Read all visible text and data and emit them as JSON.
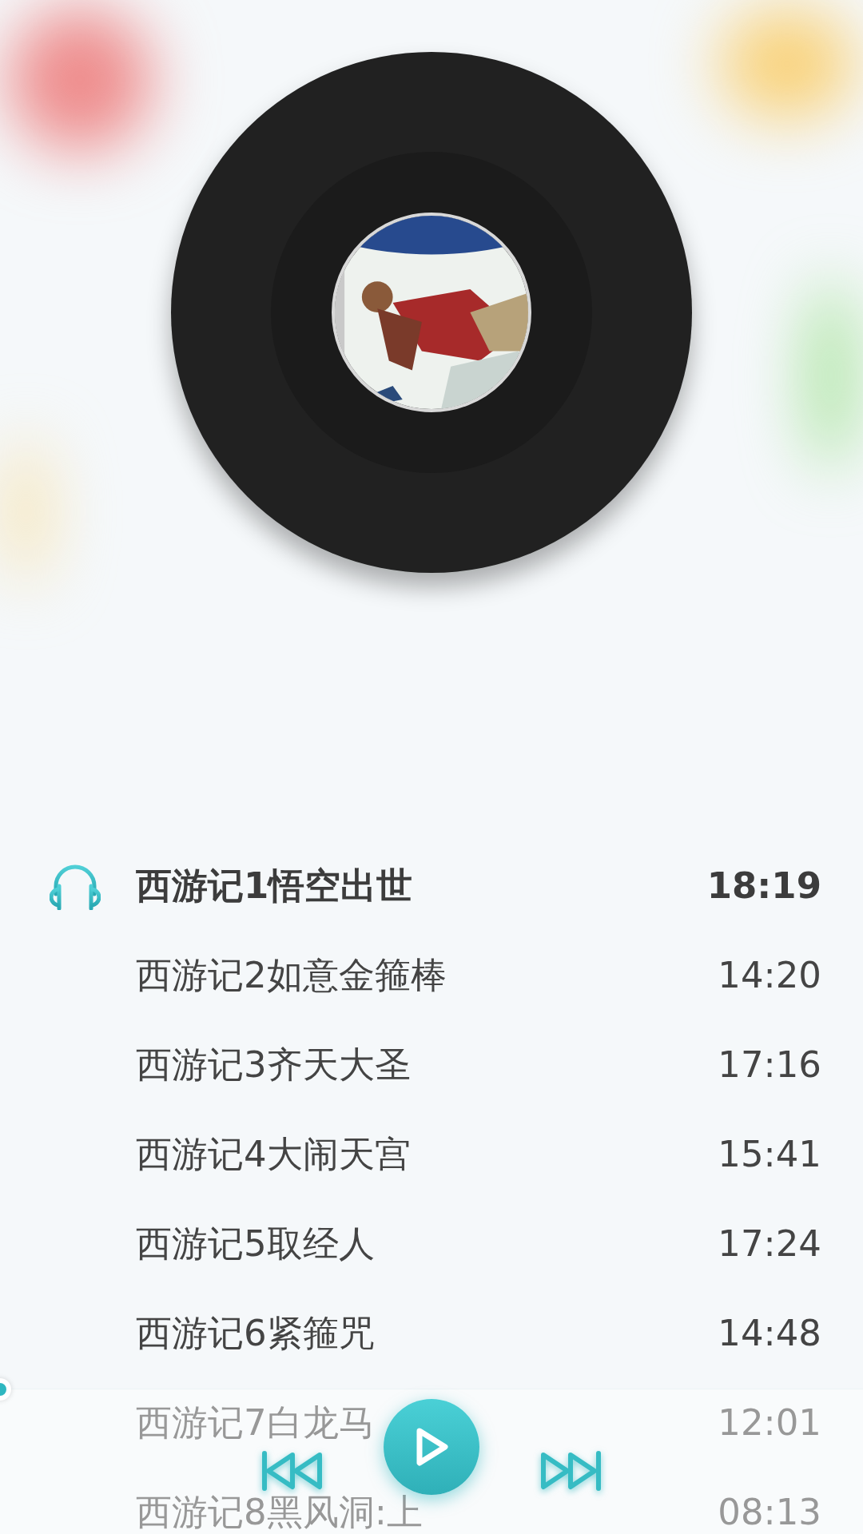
{
  "tracks": [
    {
      "title": "西游记1悟空出世",
      "duration": "18:19",
      "selected": true
    },
    {
      "title": "西游记2如意金箍棒",
      "duration": "14:20",
      "selected": false
    },
    {
      "title": "西游记3齐天大圣",
      "duration": "17:16",
      "selected": false
    },
    {
      "title": "西游记4大闹天宫",
      "duration": "15:41",
      "selected": false
    },
    {
      "title": "西游记5取经人",
      "duration": "17:24",
      "selected": false
    },
    {
      "title": "西游记6紧箍咒",
      "duration": "14:48",
      "selected": false
    },
    {
      "title": "西游记7白龙马",
      "duration": "12:01",
      "selected": false
    },
    {
      "title": "西游记8黑风洞:上",
      "duration": "08:13",
      "selected": false
    }
  ],
  "progress": {
    "level": 0
  },
  "controls": [
    {
      "kind": "previous"
    },
    {
      "kind": "play"
    },
    {
      "kind": "next"
    }
  ]
}
